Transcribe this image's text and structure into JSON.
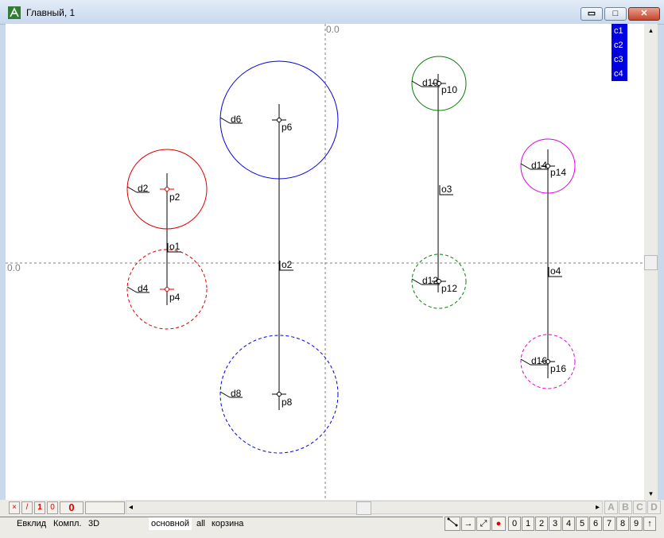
{
  "window": {
    "title": "Главный, 1",
    "minimize_glyph": "▭",
    "maximize_glyph": "□",
    "close_glyph": "✕",
    "icon": "app-figure-icon"
  },
  "canvas": {
    "axis_label_x": "0.0",
    "axis_label_y": "0.0",
    "layers": [
      "c1",
      "c2",
      "c3",
      "c4"
    ],
    "points": [
      "p2",
      "p4",
      "p6",
      "p8",
      "p10",
      "p12",
      "p14",
      "p16"
    ],
    "diameters": [
      "d2",
      "d4",
      "d6",
      "d8",
      "d10",
      "d12",
      "d14",
      "d16"
    ],
    "axes": [
      "o1",
      "o2",
      "o3",
      "o4"
    ],
    "colors": {
      "red": "#e00000",
      "blue": "#0000e0",
      "green": "#008000",
      "magenta": "#e000e0",
      "axis": "#808080",
      "layer_bg": "#0000e0"
    }
  },
  "statusbar": {
    "cross_label": "×",
    "line_label": "/",
    "one_label": "1",
    "zero_small": "0",
    "counter": "0",
    "scroll_left": "◂",
    "scroll_right": "▸",
    "corner_buttons": [
      "A",
      "B",
      "C",
      "D"
    ]
  },
  "tabs": {
    "left": [
      "Евклид",
      "Компл.",
      "3D"
    ],
    "center": [
      "основной",
      "all",
      "корзина"
    ]
  },
  "toolbar": {
    "snap_icon": "snap-icon",
    "arrow_right_glyph": "→",
    "arrow_diag_glyph": "⤢",
    "record_glyph": "●",
    "digits": [
      "0",
      "1",
      "2",
      "3",
      "4",
      "5",
      "6",
      "7",
      "8",
      "9"
    ],
    "up_glyph": "↑"
  },
  "scrollbar": {
    "up": "▴",
    "down": "▾"
  }
}
